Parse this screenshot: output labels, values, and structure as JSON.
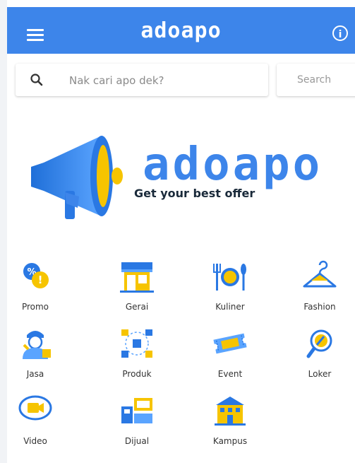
{
  "app": {
    "title": "adoapo"
  },
  "search": {
    "placeholder": "Nak cari apo dek?",
    "button_label": "Search"
  },
  "banner": {
    "brand": "adoapo",
    "tagline": "Get your best offer",
    "colors": {
      "blue": "#3d85ea",
      "yellow": "#f6c400"
    }
  },
  "categories": [
    {
      "label": "Promo",
      "icon": "percent-tag-icon"
    },
    {
      "label": "Gerai",
      "icon": "storefront-icon"
    },
    {
      "label": "Kuliner",
      "icon": "plate-cutlery-icon"
    },
    {
      "label": "Fashion",
      "icon": "hanger-icon"
    },
    {
      "label": "Jasa",
      "icon": "worker-icon"
    },
    {
      "label": "Produk",
      "icon": "products-icon"
    },
    {
      "label": "Event",
      "icon": "ticket-icon"
    },
    {
      "label": "Loker",
      "icon": "job-search-icon"
    },
    {
      "label": "Video",
      "icon": "video-camera-icon"
    },
    {
      "label": "Dijual",
      "icon": "for-sale-icon"
    },
    {
      "label": "Kampus",
      "icon": "campus-building-icon"
    }
  ]
}
